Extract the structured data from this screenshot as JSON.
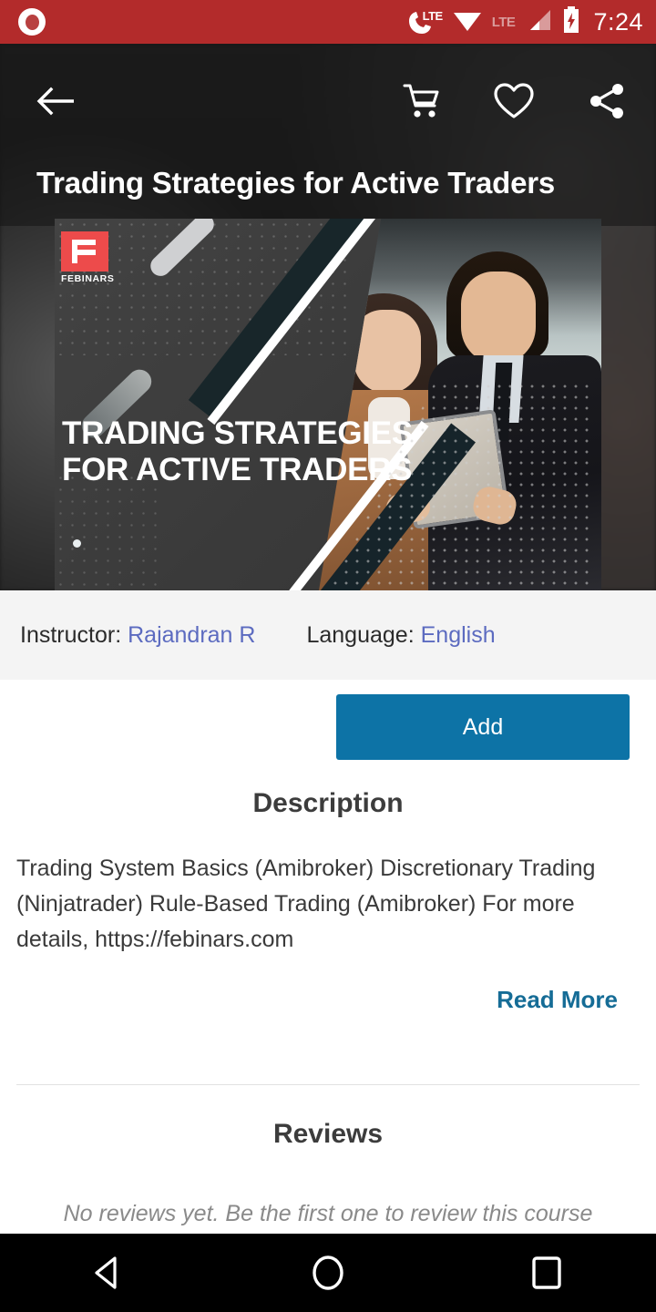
{
  "status_bar": {
    "record_icon": "record-icon",
    "phone_lte_icon": "phone-lte-icon",
    "lte_label": "LTE",
    "wifi_icon": "wifi-icon",
    "lte_secondary_label": "LTE",
    "signal_icon": "signal-bars-icon",
    "battery_icon": "battery-charging-icon",
    "time": "7:24",
    "background_color": "#B32B2B"
  },
  "appbar": {
    "back_icon": "back-arrow-icon",
    "cart_icon": "shopping-cart-icon",
    "wishlist_icon": "heart-icon",
    "share_icon": "share-icon",
    "title": "Trading Strategies for Active Traders"
  },
  "banner": {
    "logo_text": "FEBINARS",
    "logo_color": "#ED4B4B",
    "heading": "TRADING STRATEGIES FOR ACTIVE TRADERS",
    "image_alt": "two business people reviewing a tablet"
  },
  "meta": {
    "instructor_label": "Instructor:",
    "instructor_value": "Rajandran R",
    "language_label": "Language:",
    "language_value": "English",
    "link_color": "#5C6BC0",
    "background_color": "#F4F4F4"
  },
  "main": {
    "add_button_label": "Add",
    "add_button_color": "#0D73A6",
    "description_title": "Description",
    "description_body": "Trading System Basics (Amibroker) Discretionary Trading (Ninjatrader) Rule-Based Trading (Amibroker) For more details, https://febinars.com",
    "read_more_label": "Read More",
    "read_more_color": "#156C96",
    "reviews_title": "Reviews",
    "no_reviews_text": "No reviews yet. Be the first one to review this course"
  },
  "navbar": {
    "back_icon": "nav-back-triangle-icon",
    "home_icon": "nav-home-circle-icon",
    "recents_icon": "nav-recents-square-icon"
  }
}
